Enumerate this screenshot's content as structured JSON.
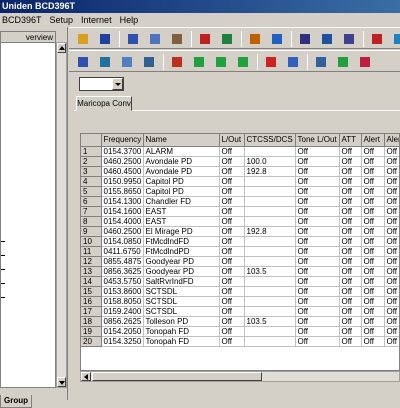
{
  "window": {
    "title": "Uniden BCD396T"
  },
  "menu": [
    "BCD396T",
    "Setup",
    "Internet",
    "Help"
  ],
  "left_pane": {
    "tab_label": "verview",
    "group_tab": "Group"
  },
  "tab": {
    "label": "Maricopa Conv"
  },
  "combo": {
    "value": ""
  },
  "table": {
    "columns": [
      "",
      "Frequency",
      "Name",
      "L/Out",
      "CTCSS/DCS",
      "Tone L/Out",
      "ATT",
      "Alert",
      "Alert"
    ],
    "rows": [
      [
        "1",
        "0154.3700",
        "ALARM",
        "Off",
        "",
        "Off",
        "Off",
        "Off",
        "Off"
      ],
      [
        "2",
        "0460.2500",
        "Avondale PD",
        "Off",
        "100.0",
        "Off",
        "Off",
        "Off",
        "Off"
      ],
      [
        "3",
        "0460.4500",
        "Avondale PD",
        "Off",
        "192.8",
        "Off",
        "Off",
        "Off",
        "Off"
      ],
      [
        "4",
        "0150.9950",
        "Capitol PD",
        "Off",
        "",
        "Off",
        "Off",
        "Off",
        "Off"
      ],
      [
        "5",
        "0155.8650",
        "Capitol PD",
        "Off",
        "",
        "Off",
        "Off",
        "Off",
        "Off"
      ],
      [
        "6",
        "0154.1300",
        "Chandler FD",
        "Off",
        "",
        "Off",
        "Off",
        "Off",
        "Off"
      ],
      [
        "7",
        "0154.1600",
        "EAST",
        "Off",
        "",
        "Off",
        "Off",
        "Off",
        "Off"
      ],
      [
        "8",
        "0154.4000",
        "EAST",
        "Off",
        "",
        "Off",
        "Off",
        "Off",
        "Off"
      ],
      [
        "9",
        "0460.2500",
        "El Mirage PD",
        "Off",
        "192.8",
        "Off",
        "Off",
        "Off",
        "Off"
      ],
      [
        "10",
        "0154.0850",
        "FtMcdlndFD",
        "Off",
        "",
        "Off",
        "Off",
        "Off",
        "Off"
      ],
      [
        "11",
        "0411.6750",
        "FtMcdlndPD",
        "Off",
        "",
        "Off",
        "Off",
        "Off",
        "Off"
      ],
      [
        "12",
        "0855.4875",
        "Goodyear PD",
        "Off",
        "",
        "Off",
        "Off",
        "Off",
        "Off"
      ],
      [
        "13",
        "0856.3625",
        "Goodyear PD",
        "Off",
        "103.5",
        "Off",
        "Off",
        "Off",
        "Off"
      ],
      [
        "14",
        "0453.5750",
        "SaltRvrIndFD",
        "Off",
        "",
        "Off",
        "Off",
        "Off",
        "Off"
      ],
      [
        "15",
        "0153.8600",
        "SCTSDL",
        "Off",
        "",
        "Off",
        "Off",
        "Off",
        "Off"
      ],
      [
        "16",
        "0158.8050",
        "SCTSDL",
        "Off",
        "",
        "Off",
        "Off",
        "Off",
        "Off"
      ],
      [
        "17",
        "0159.2400",
        "SCTSDL",
        "Off",
        "",
        "Off",
        "Off",
        "Off",
        "Off"
      ],
      [
        "18",
        "0856.2625",
        "Tolleson PD",
        "Off",
        "103.5",
        "Off",
        "Off",
        "Off",
        "Off"
      ],
      [
        "19",
        "0154.2050",
        "Tonopah FD",
        "Off",
        "",
        "Off",
        "Off",
        "Off",
        "Off"
      ],
      [
        "20",
        "0154.3250",
        "Tonopah FD",
        "Off",
        "",
        "Off",
        "Off",
        "Off",
        "Off"
      ]
    ]
  },
  "toolbar1": [
    {
      "name": "open-folder-icon",
      "color": "#d8a020"
    },
    {
      "name": "save-icon",
      "color": "#2040a0"
    },
    {
      "name": "cut-icon",
      "color": "#3050b0"
    },
    {
      "name": "copy-icon",
      "color": "#5070c0"
    },
    {
      "name": "paste-icon",
      "color": "#806040"
    },
    {
      "name": "delete-icon",
      "color": "#c02020"
    },
    {
      "name": "scanner-icon",
      "color": "#208040"
    },
    {
      "name": "download-icon",
      "color": "#c06000"
    },
    {
      "name": "upload-icon",
      "color": "#2060c0"
    },
    {
      "name": "channel-icon",
      "color": "#303080"
    },
    {
      "name": "system-icon",
      "color": "#2050a0"
    },
    {
      "name": "group-icon",
      "color": "#404090"
    },
    {
      "name": "sort-icon",
      "color": "#c02020"
    },
    {
      "name": "write-icon",
      "color": "#2080c0"
    }
  ],
  "toolbar2": [
    {
      "name": "new-system-icon",
      "color": "#3050b0"
    },
    {
      "name": "new-group-icon",
      "color": "#2070a0"
    },
    {
      "name": "new-channel-icon",
      "color": "#5080c0"
    },
    {
      "name": "edit-icon",
      "color": "#306090"
    },
    {
      "name": "lock-icon",
      "color": "#c03020"
    },
    {
      "name": "move-icon",
      "color": "#20a040"
    },
    {
      "name": "arrow-down-icon",
      "color": "#20a040"
    },
    {
      "name": "arrow-up-icon",
      "color": "#20a040"
    },
    {
      "name": "remove-icon",
      "color": "#d02020"
    },
    {
      "name": "find-icon",
      "color": "#3060c0"
    },
    {
      "name": "database-icon",
      "color": "#3060a0"
    },
    {
      "name": "sort-az-icon",
      "color": "#20a040"
    },
    {
      "name": "sort-za-icon",
      "color": "#c02040"
    }
  ]
}
